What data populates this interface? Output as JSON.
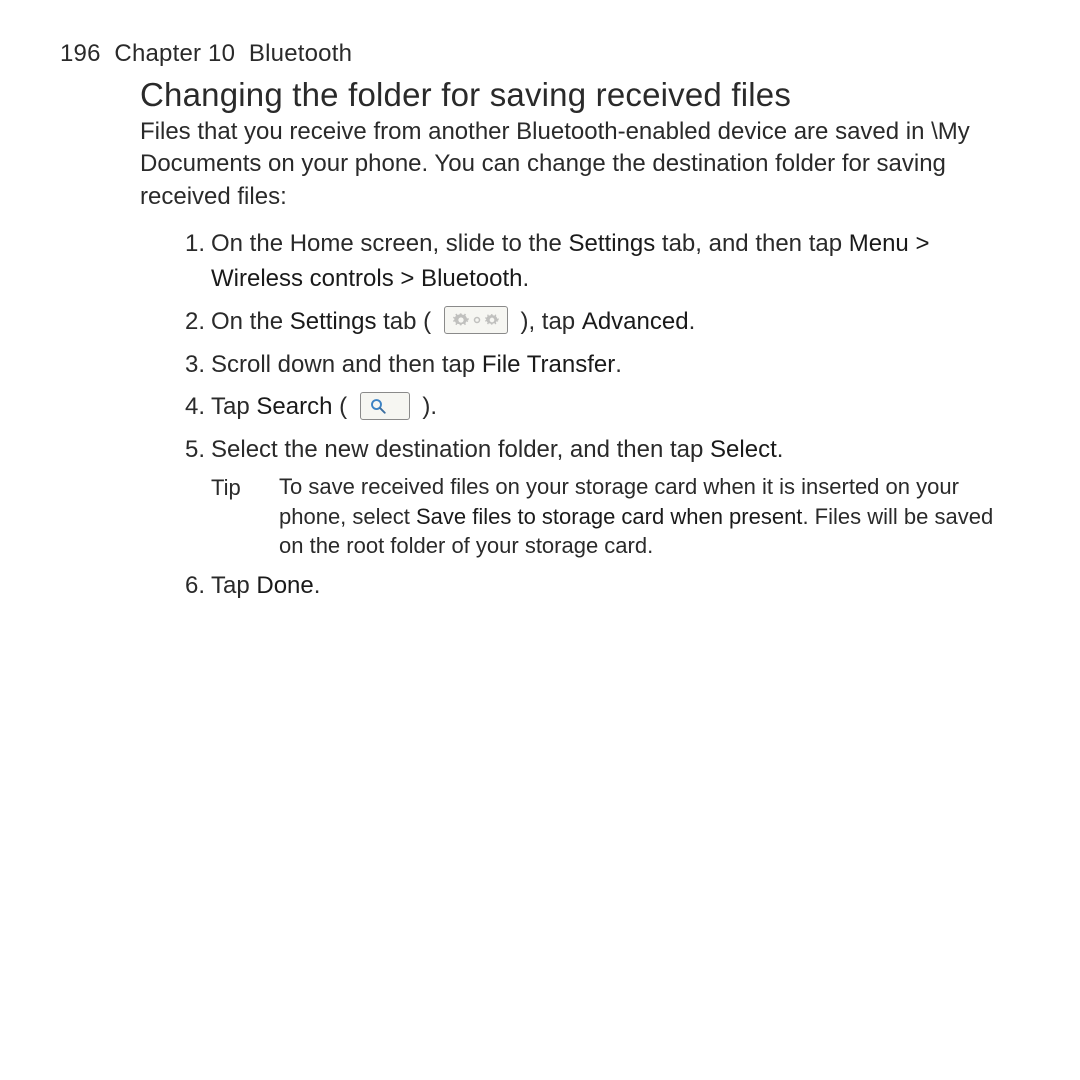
{
  "header": {
    "page_number": "196",
    "chapter": "Chapter 10",
    "chapter_title": "Bluetooth"
  },
  "section": {
    "title": "Changing the folder for saving received files",
    "intro": "Files that you receive from another Bluetooth-enabled device are saved in \\My Documents on your phone. You can change the destination folder for saving received files:"
  },
  "steps": {
    "s1_a": "On the Home screen, slide to the ",
    "s1_b": "Settings",
    "s1_c": " tab, and then tap ",
    "s1_d": "Menu > Wireless controls > Bluetooth",
    "s1_e": ".",
    "s2_a": "On the ",
    "s2_b": "Settings",
    "s2_c": " tab ( ",
    "s2_d": " ), tap ",
    "s2_e": "Advanced",
    "s2_f": ".",
    "s3_a": "Scroll down and then tap ",
    "s3_b": "File Transfer",
    "s3_c": ".",
    "s4_a": "Tap ",
    "s4_b": "Search",
    "s4_c": " ( ",
    "s4_d": " ).",
    "s5_a": "Select the new destination folder, and then tap ",
    "s5_b": "Select",
    "s5_c": ".",
    "s6_a": "Tap ",
    "s6_b": "Done",
    "s6_c": "."
  },
  "tip": {
    "label": "Tip",
    "t1": "To save received files on your storage card when it is inserted on your phone, select ",
    "t2": "Save files to storage card when present",
    "t3": ". Files will be saved on the root folder of your storage card."
  },
  "numbers": {
    "n1": "1.",
    "n2": "2.",
    "n3": "3.",
    "n4": "4.",
    "n5": "5.",
    "n6": "6."
  }
}
